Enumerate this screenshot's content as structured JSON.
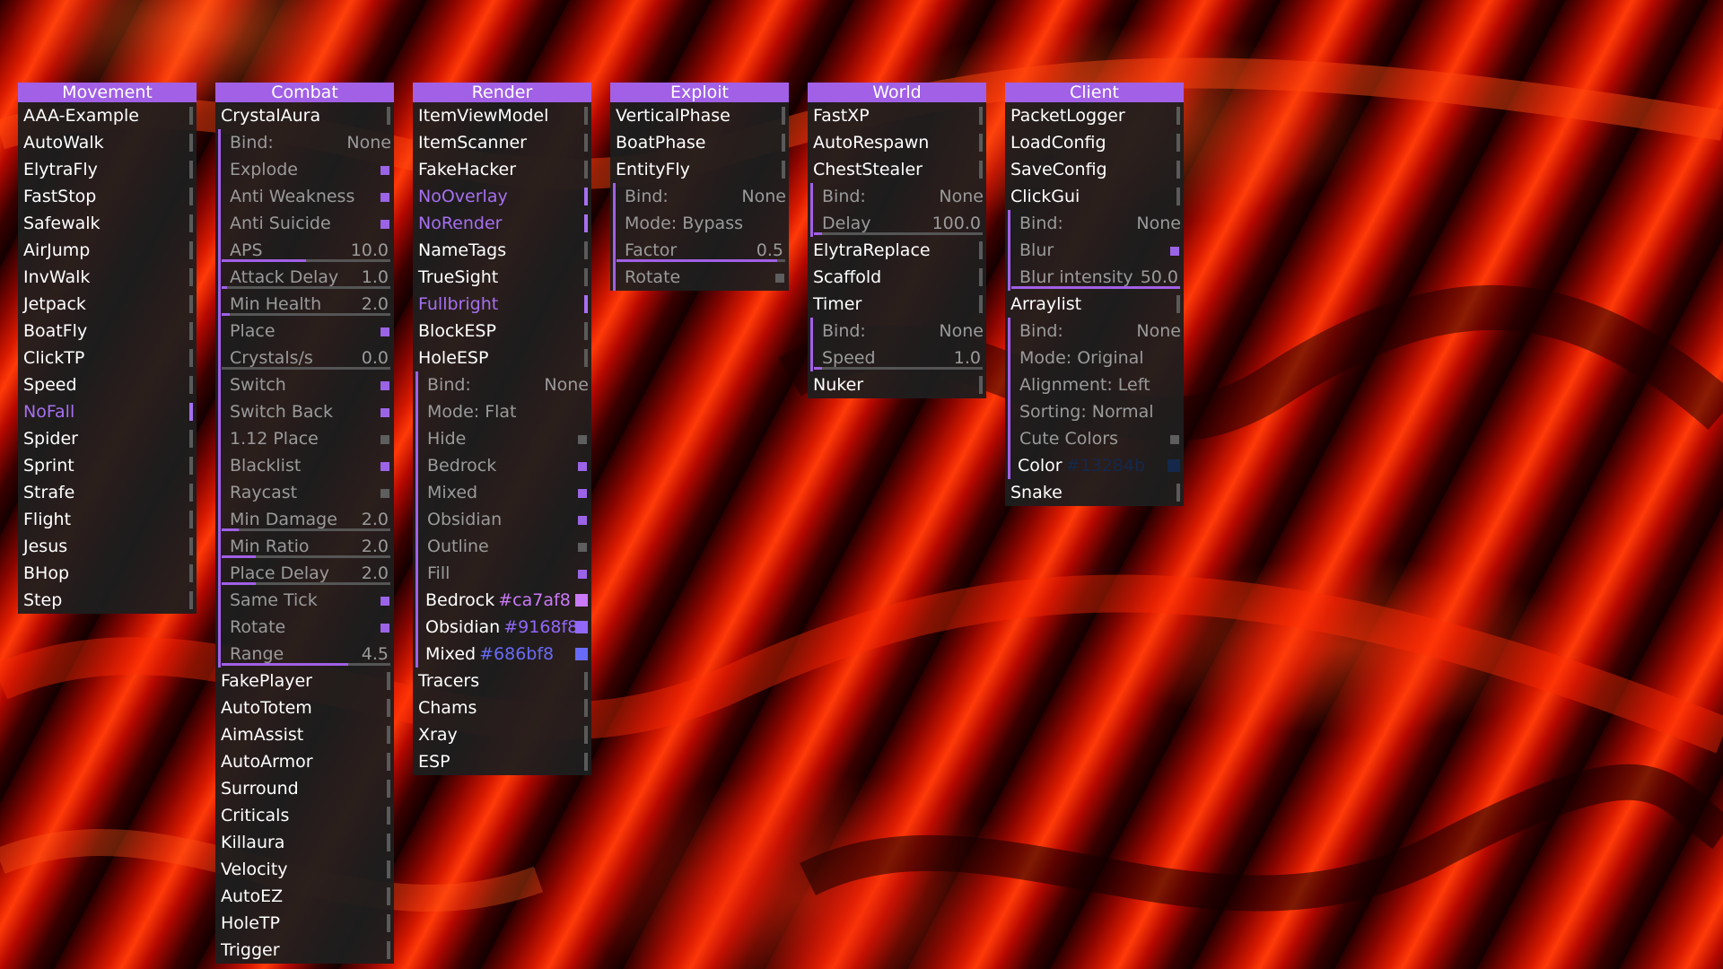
{
  "accent": "#a160e6",
  "movement": {
    "title": "Movement",
    "items": [
      {
        "label": "AAA-Example"
      },
      {
        "label": "AutoWalk"
      },
      {
        "label": "ElytraFly"
      },
      {
        "label": "FastStop"
      },
      {
        "label": "Safewalk"
      },
      {
        "label": "AirJump"
      },
      {
        "label": "InvWalk"
      },
      {
        "label": "Jetpack"
      },
      {
        "label": "BoatFly"
      },
      {
        "label": "ClickTP"
      },
      {
        "label": "Speed"
      },
      {
        "label": "NoFall",
        "enabled": true
      },
      {
        "label": "Spider"
      },
      {
        "label": "Sprint"
      },
      {
        "label": "Strafe"
      },
      {
        "label": "Flight"
      },
      {
        "label": "Jesus"
      },
      {
        "label": "BHop"
      },
      {
        "label": "Step"
      }
    ]
  },
  "combat": {
    "title": "Combat",
    "crystal_label": "CrystalAura",
    "settings": {
      "bind_label": "Bind:",
      "bind_value": "None",
      "explode": "Explode",
      "anti_weakness": "Anti Weakness",
      "anti_suicide": "Anti Suicide",
      "aps_label": "APS",
      "aps_value": "10.0",
      "aps_fill": 0.5,
      "attack_delay_label": "Attack Delay",
      "attack_delay_value": "1.0",
      "attack_delay_fill": 0.03,
      "min_health_label": "Min Health",
      "min_health_value": "2.0",
      "min_health_fill": 0.05,
      "place": "Place",
      "crystals_label": "Crystals/s",
      "crystals_value": "0.0",
      "crystals_fill": 0.0,
      "switch": "Switch",
      "switch_back": "Switch Back",
      "place_112": "1.12 Place",
      "blacklist": "Blacklist",
      "raycast": "Raycast",
      "min_damage_label": "Min Damage",
      "min_damage_value": "2.0",
      "min_damage_fill": 0.1,
      "min_ratio_label": "Min Ratio",
      "min_ratio_value": "2.0",
      "min_ratio_fill": 0.2,
      "place_delay_label": "Place Delay",
      "place_delay_value": "2.0",
      "place_delay_fill": 0.2,
      "same_tick": "Same Tick",
      "rotate": "Rotate",
      "range_label": "Range",
      "range_value": "4.5",
      "range_fill": 0.75
    },
    "items": [
      {
        "label": "FakePlayer"
      },
      {
        "label": "AutoTotem"
      },
      {
        "label": "AimAssist"
      },
      {
        "label": "AutoArmor"
      },
      {
        "label": "Surround"
      },
      {
        "label": "Criticals"
      },
      {
        "label": "Killaura"
      },
      {
        "label": "Velocity"
      },
      {
        "label": "AutoEZ"
      },
      {
        "label": "HoleTP"
      },
      {
        "label": "Trigger"
      }
    ]
  },
  "render": {
    "title": "Render",
    "items_top": [
      {
        "label": "ItemViewModel"
      },
      {
        "label": "ItemScanner"
      },
      {
        "label": "FakeHacker"
      },
      {
        "label": "NoOverlay",
        "enabled": true
      },
      {
        "label": "NoRender",
        "enabled": true
      },
      {
        "label": "NameTags"
      },
      {
        "label": "TrueSight"
      },
      {
        "label": "Fullbright",
        "enabled": true
      },
      {
        "label": "BlockESP"
      },
      {
        "label": "HoleESP"
      }
    ],
    "hole": {
      "bind_label": "Bind:",
      "bind_value": "None",
      "mode": "Mode: Flat",
      "hide": "Hide",
      "bedrock": "Bedrock",
      "mixed": "Mixed",
      "obsidian": "Obsidian",
      "outline": "Outline",
      "fill": "Fill",
      "bedrock_color_label": "Bedrock",
      "bedrock_color": "#ca7af8",
      "obsidian_color_label": "Obsidian",
      "obsidian_color": "#9168f8",
      "mixed_color_label": "Mixed",
      "mixed_color": "#686bf8"
    },
    "items_bottom": [
      {
        "label": "Tracers"
      },
      {
        "label": "Chams"
      },
      {
        "label": "Xray"
      },
      {
        "label": "ESP"
      }
    ]
  },
  "exploit": {
    "title": "Exploit",
    "items": [
      {
        "label": "VerticalPhase"
      },
      {
        "label": "BoatPhase"
      },
      {
        "label": "EntityFly"
      }
    ],
    "entityfly": {
      "bind_label": "Bind:",
      "bind_value": "None",
      "mode": "Mode: Bypass",
      "factor_label": "Factor",
      "factor_value": "0.5",
      "factor_fill": 0.95,
      "rotate": "Rotate"
    }
  },
  "world": {
    "title": "World",
    "items_a": [
      {
        "label": "FastXP"
      },
      {
        "label": "AutoRespawn"
      },
      {
        "label": "ChestStealer"
      }
    ],
    "chest": {
      "bind_label": "Bind:",
      "bind_value": "None",
      "delay_label": "Delay",
      "delay_value": "100.0",
      "delay_fill": 0.05
    },
    "items_b": [
      {
        "label": "ElytraReplace"
      },
      {
        "label": "Scaffold"
      },
      {
        "label": "Timer"
      }
    ],
    "timer": {
      "bind_label": "Bind:",
      "bind_value": "None",
      "speed_label": "Speed",
      "speed_value": "1.0",
      "speed_fill": 0.05
    },
    "items_c": [
      {
        "label": "Nuker"
      }
    ]
  },
  "client": {
    "title": "Client",
    "items_a": [
      {
        "label": "PacketLogger"
      },
      {
        "label": "LoadConfig"
      },
      {
        "label": "SaveConfig"
      },
      {
        "label": "ClickGui"
      }
    ],
    "clickgui": {
      "bind_label": "Bind:",
      "bind_value": "None",
      "blur": "Blur",
      "blur_int_label": "Blur intensity",
      "blur_int_value": "50.0",
      "blur_fill": 1.0
    },
    "arraylist_label": "Arraylist",
    "arraylist": {
      "bind_label": "Bind:",
      "bind_value": "None",
      "mode": "Mode: Original",
      "alignment": "Alignment: Left",
      "sorting": "Sorting: Normal",
      "cute": "Cute Colors",
      "color_label": "Color",
      "color_value": "#13284b"
    },
    "items_b": [
      {
        "label": "Snake"
      }
    ]
  }
}
